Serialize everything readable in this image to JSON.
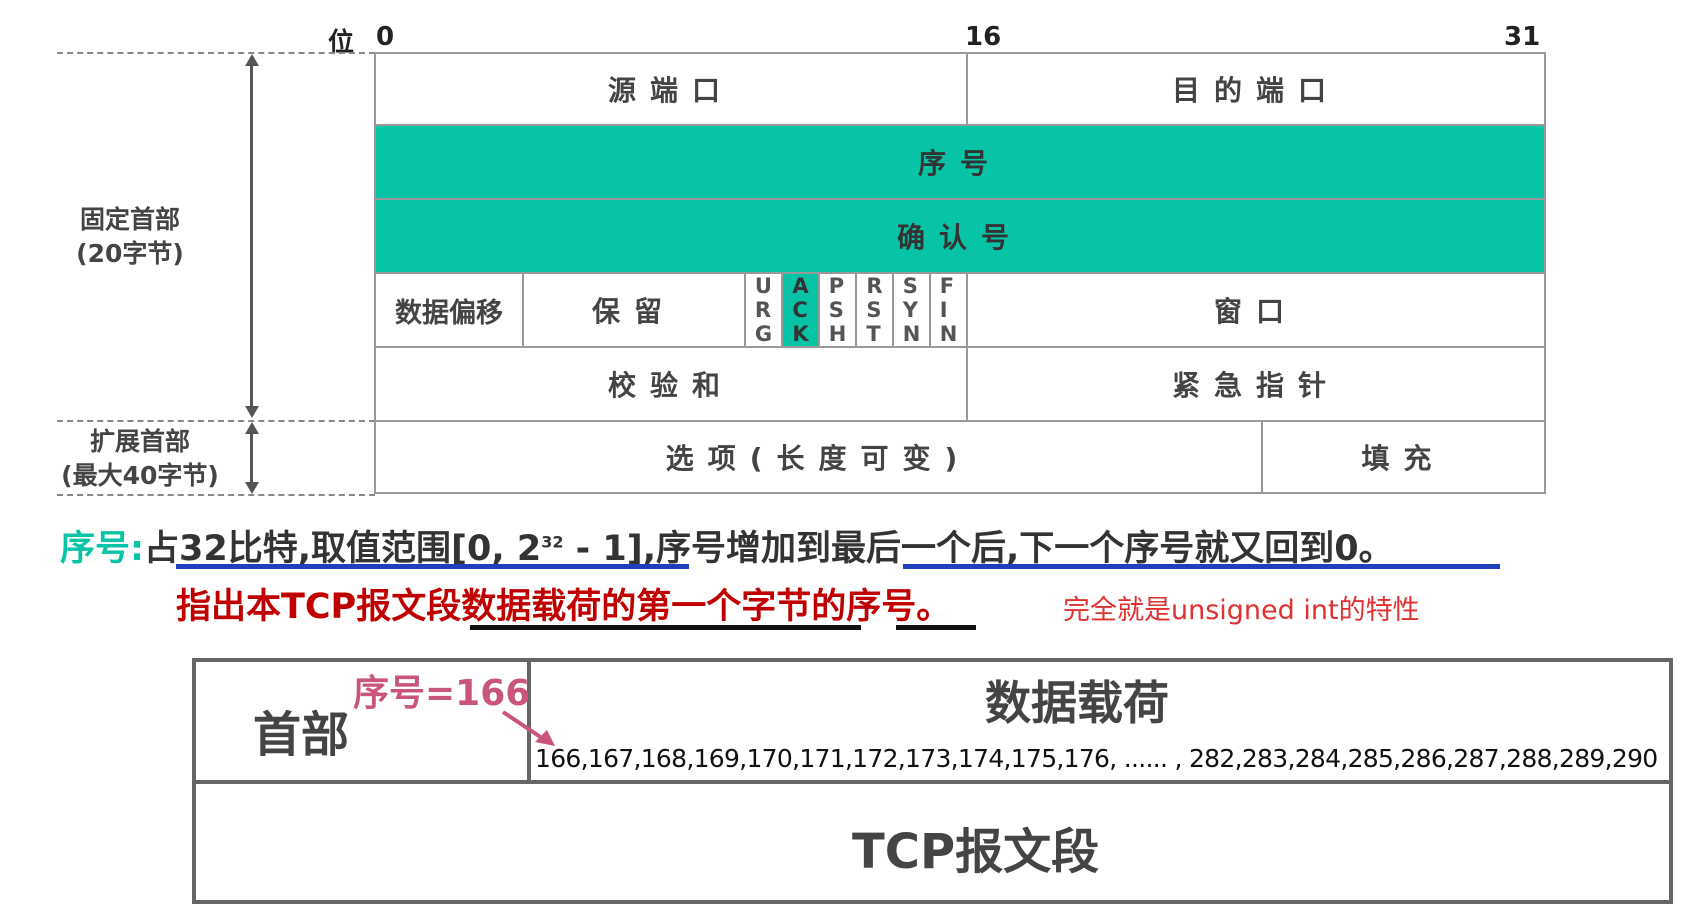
{
  "bit_axis": {
    "label": "位",
    "b0": "0",
    "b16": "16",
    "b31": "31"
  },
  "side": {
    "fixed_l1": "固定首部",
    "fixed_l2": "(20字节)",
    "ext_l1": "扩展首部",
    "ext_l2": "(最大40字节)"
  },
  "header": {
    "src_port": "源端口",
    "dst_port": "目的端口",
    "seq": "序号",
    "ack": "确认号",
    "data_offset": "数据偏移",
    "reserved": "保留",
    "flags": [
      {
        "name": "URG",
        "highlight": false
      },
      {
        "name": "ACK",
        "highlight": true
      },
      {
        "name": "PSH",
        "highlight": false
      },
      {
        "name": "RST",
        "highlight": false
      },
      {
        "name": "SYN",
        "highlight": false
      },
      {
        "name": "FIN",
        "highlight": false
      }
    ],
    "window": "窗口",
    "checksum": "校验和",
    "urgent": "紧急指针",
    "options": "选项(长度可变)",
    "padding": "填充"
  },
  "desc": {
    "label": "序号:",
    "p1": "占32比特,取值范围[0, 2",
    "sup": "32",
    "p2": " - 1],序号增加到最后一个后,下一个序号就又回到0。",
    "line2": "指出本TCP报文段数据载荷的第一个字节的序号。",
    "note": "完全就是unsigned int的特性"
  },
  "segment": {
    "header_label": "首部",
    "seq_label": "序号=166",
    "payload_label": "数据载荷",
    "bytes": "166,167,168,169,170,171,172,173,174,175,176, ...... , 282,283,284,285,286,287,288,289,290",
    "segment_label": "TCP报文段"
  },
  "colors": {
    "teal": "#07c4a7",
    "red": "#c00000",
    "blue": "#1f3fbf",
    "pink": "#c9557e"
  }
}
